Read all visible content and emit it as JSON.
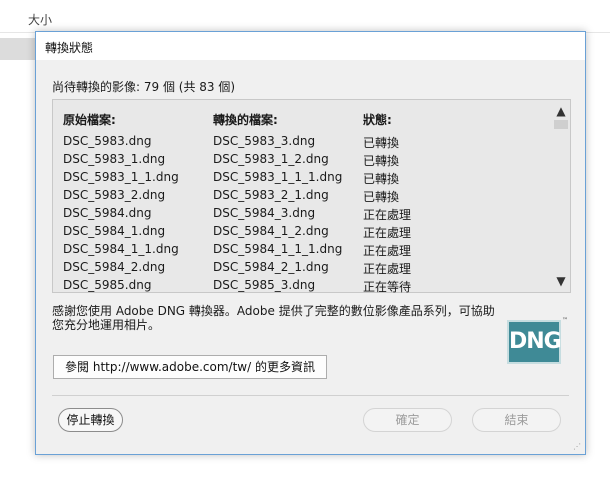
{
  "background": {
    "column_label": "大小"
  },
  "dialog": {
    "title": "轉換狀態",
    "pending_text": "尚待轉換的影像: 79 個 (共 83 個)",
    "columns": [
      "原始檔案:",
      "轉換的檔案:",
      "狀態:"
    ],
    "rows": [
      [
        "DSC_5983.dng",
        "DSC_5983_3.dng",
        "已轉換"
      ],
      [
        "DSC_5983_1.dng",
        "DSC_5983_1_2.dng",
        "已轉換"
      ],
      [
        "DSC_5983_1_1.dng",
        "DSC_5983_1_1_1.dng",
        "已轉換"
      ],
      [
        "DSC_5983_2.dng",
        "DSC_5983_2_1.dng",
        "已轉換"
      ],
      [
        "DSC_5984.dng",
        "DSC_5984_3.dng",
        "正在處理"
      ],
      [
        "DSC_5984_1.dng",
        "DSC_5984_1_2.dng",
        "正在處理"
      ],
      [
        "DSC_5984_1_1.dng",
        "DSC_5984_1_1_1.dng",
        "正在處理"
      ],
      [
        "DSC_5984_2.dng",
        "DSC_5984_2_1.dng",
        "正在處理"
      ],
      [
        "DSC_5985.dng",
        "DSC_5985_3.dng",
        "正在等待"
      ]
    ],
    "thanks_text": "感謝您使用 Adobe DNG 轉換器。Adobe 提供了完整的數位影像產品系列，可協助您充分地運用相片。",
    "logo_text": "DNG",
    "logo_tm": "™",
    "more_info_button": "參閱 http://www.adobe.com/tw/ 的更多資訊",
    "stop_button": "停止轉換",
    "ok_button": "確定",
    "close_button": "結束",
    "scroll_up_icon": "▲",
    "scroll_down_icon": "▼",
    "resize_grip_icon": "⋰",
    "colors": {
      "border": "#6aa1d6",
      "logo": "#3f8a96",
      "disabled_text": "#9c9c9c"
    }
  }
}
